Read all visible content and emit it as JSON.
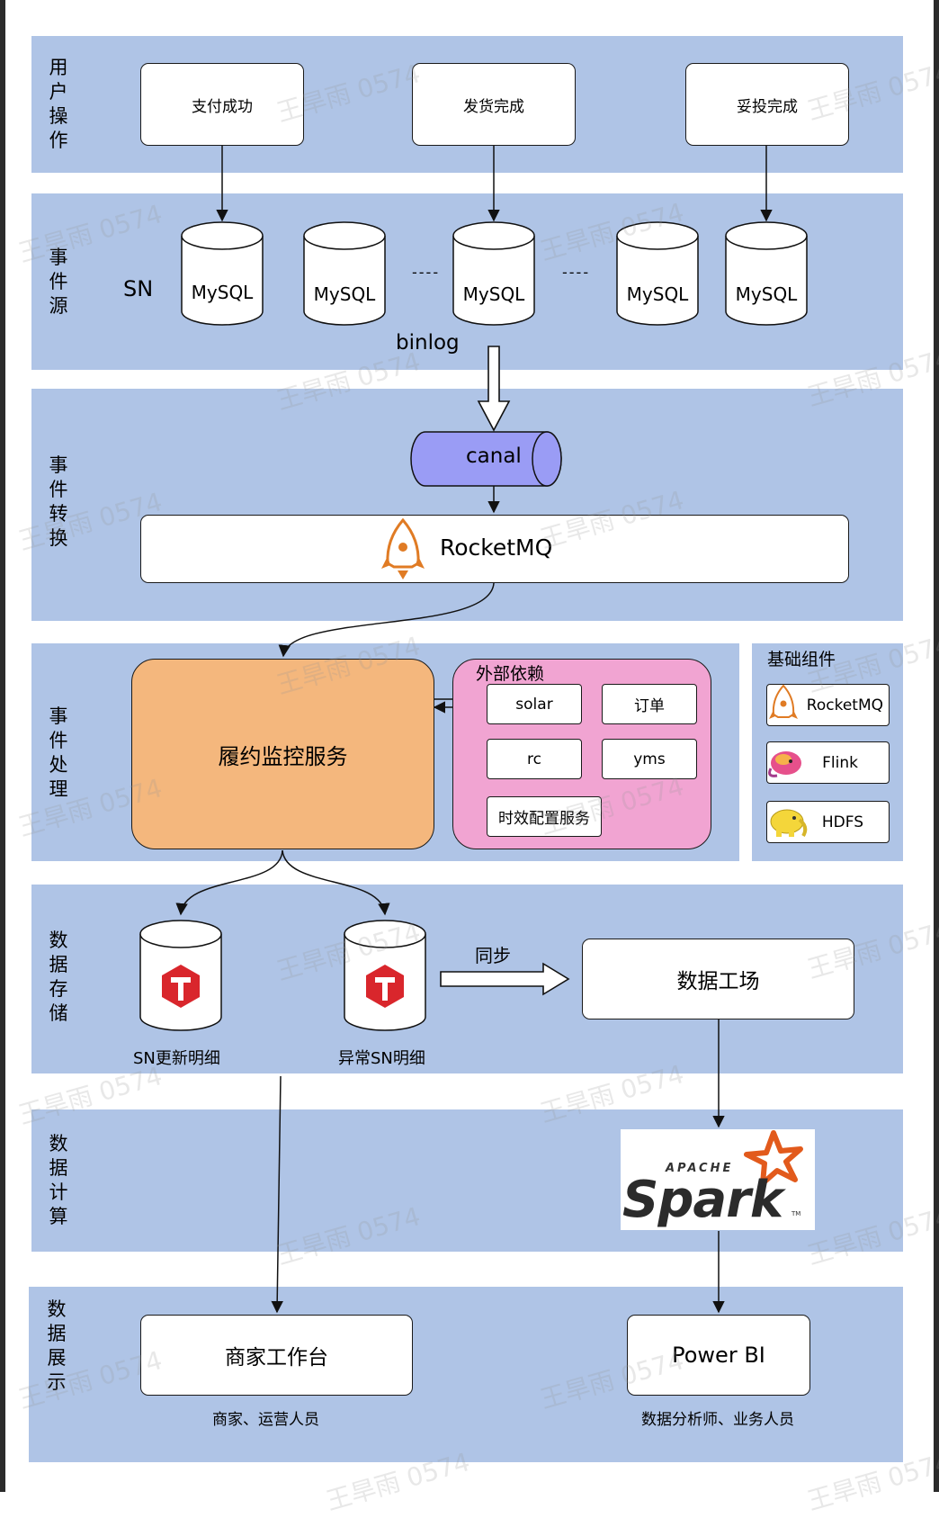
{
  "layers": {
    "user_ops": "用户操作",
    "event_source": "事件源",
    "event_transform": "事件转换",
    "event_process": "事件处理",
    "data_storage": "数据存储",
    "data_compute": "数据计算",
    "data_display": "数据展示"
  },
  "user_ops": [
    "支付成功",
    "发货完成",
    "妥投完成"
  ],
  "event_source": {
    "sn_label": "SN",
    "dbs": [
      "MySQL",
      "MySQL",
      "MySQL",
      "MySQL",
      "MySQL"
    ],
    "ellipsis": [
      "----",
      "----"
    ],
    "binlog_label": "binlog"
  },
  "event_transform": {
    "canal": "canal",
    "rocketmq": "RocketMQ"
  },
  "event_process": {
    "main_service": "履约监控服务",
    "external_title": "外部依赖",
    "deps": [
      "solar",
      "订单",
      "rc",
      "yms",
      "时效配置服务"
    ]
  },
  "base_components": {
    "title": "基础组件",
    "items": [
      "RocketMQ",
      "Flink",
      "HDFS"
    ]
  },
  "data_storage": {
    "stores": [
      "SN更新明细",
      "异常SN明细"
    ],
    "sync_label": "同步",
    "warehouse": "数据工场"
  },
  "data_compute": {
    "spark_apache": "APACHE",
    "spark_name": "Spark",
    "spark_tm": "TM"
  },
  "data_display": {
    "merchant_console": "商家工作台",
    "merchant_users": "商家、运营人员",
    "powerbi": "Power BI",
    "powerbi_users": "数据分析师、业务人员"
  },
  "watermark": "王旱雨 0574",
  "colors": {
    "band": "#afc4e6",
    "canal": "#9a9cf5",
    "service": "#f4b77d",
    "external": "#f1a4d2",
    "rocket": "#e07b24",
    "tidb": "#d9262c"
  }
}
